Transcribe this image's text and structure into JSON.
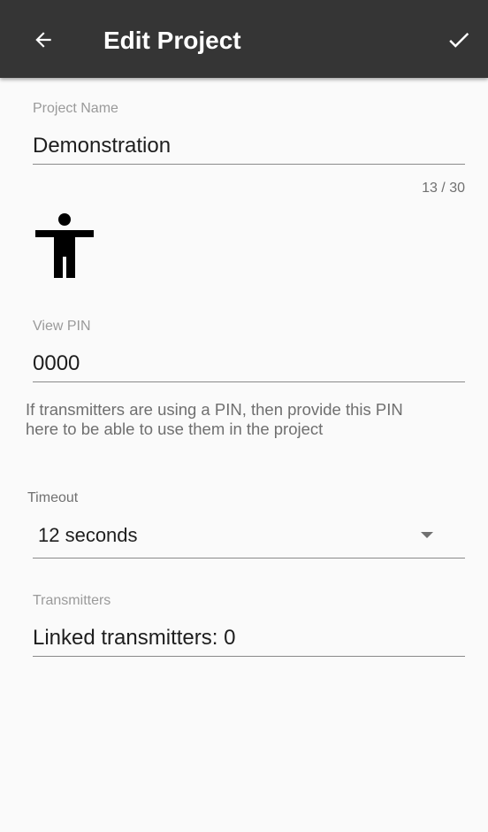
{
  "appbar": {
    "title": "Edit Project",
    "back_icon": "arrow-left-icon",
    "confirm_icon": "check-icon",
    "background": "#353535"
  },
  "project_name": {
    "label": "Project Name",
    "value": "Demonstration",
    "counter": "13 / 30"
  },
  "project_icon": "accessibility-person-icon",
  "view_pin": {
    "label": "View PIN",
    "value": "0000",
    "helper": "If transmitters are using a PIN, then provide this PIN here to be able to use them in the project"
  },
  "timeout": {
    "label": "Timeout",
    "value": "12 seconds"
  },
  "transmitters": {
    "label": "Transmitters",
    "value": "Linked transmitters: 0"
  }
}
